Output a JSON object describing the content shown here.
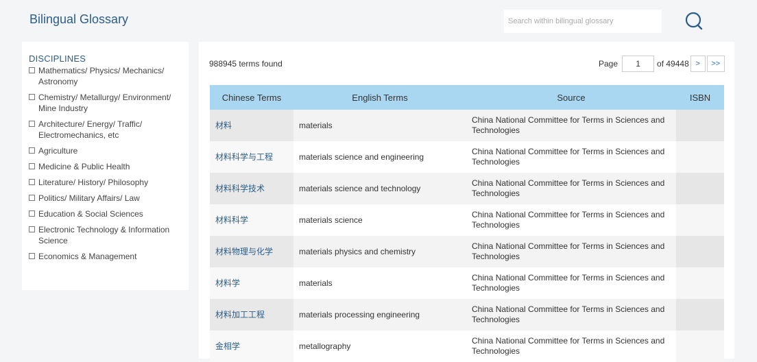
{
  "header": {
    "title": "Bilingual Glossary"
  },
  "search": {
    "placeholder": "Search within bilingual glossary"
  },
  "sidebar": {
    "title": "DISCIPLINES",
    "items": [
      "Mathematics/ Physics/ Mechanics/ Astronomy",
      "Chemistry/ Metallurgy/ Environment/ Mine Industry",
      "Architecture/ Energy/ Traffic/ Electromechanics, etc",
      "Agriculture",
      "Medicine & Public Health",
      "Literature/ History/ Philosophy",
      "Politics/ Military Affairs/ Law",
      "Education & Social Sciences",
      "Electronic Technology & Information Science",
      "Economics & Management"
    ]
  },
  "results": {
    "count_text": "988945 terms found",
    "pager": {
      "page_label": "Page",
      "page_value": "1",
      "of_label": "of 49448",
      "next": ">",
      "last": ">>"
    },
    "columns": [
      "Chinese Terms",
      "English Terms",
      "Source",
      "ISBN"
    ],
    "rows": [
      {
        "cn": "材料",
        "en": "materials",
        "source": "China National Committee for Terms in Sciences and Technologies",
        "isbn": ""
      },
      {
        "cn": "材料科学与工程",
        "en": "materials science and engineering",
        "source": "China National Committee for Terms in Sciences and Technologies",
        "isbn": ""
      },
      {
        "cn": "材料科学技术",
        "en": "materials science and technology",
        "source": "China National Committee for Terms in Sciences and Technologies",
        "isbn": ""
      },
      {
        "cn": "材料科学",
        "en": "materials science",
        "source": "China National Committee for Terms in Sciences and Technologies",
        "isbn": ""
      },
      {
        "cn": "材料物理与化学",
        "en": "materials physics and chemistry",
        "source": "China National Committee for Terms in Sciences and Technologies",
        "isbn": ""
      },
      {
        "cn": "材料学",
        "en": "materials",
        "source": "China National Committee for Terms in Sciences and Technologies",
        "isbn": ""
      },
      {
        "cn": "材料加工工程",
        "en": "materials processing engineering",
        "source": "China National Committee for Terms in Sciences and Technologies",
        "isbn": ""
      },
      {
        "cn": "金相学",
        "en": "metallography",
        "source": "China National Committee for Terms in Sciences and Technologies",
        "isbn": ""
      }
    ]
  },
  "icons": {
    "search": "search-icon"
  },
  "colors": {
    "accent": "#2a5d8a",
    "table_header": "#a9d7f2",
    "link": "#2a6fb3"
  }
}
